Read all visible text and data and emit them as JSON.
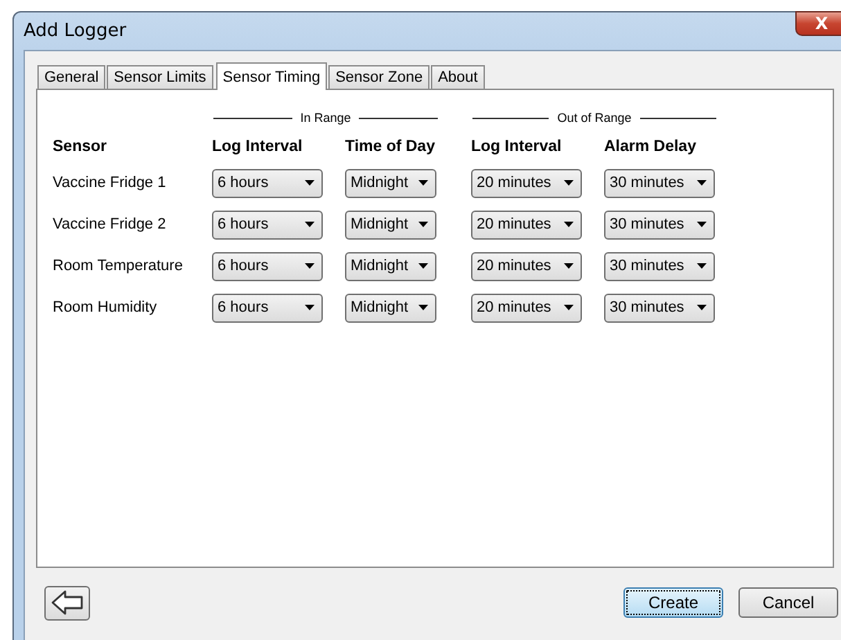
{
  "window": {
    "title": "Add Logger",
    "close_label": "X"
  },
  "tabs": [
    {
      "label": "General",
      "selected": false
    },
    {
      "label": "Sensor Limits",
      "selected": false
    },
    {
      "label": "Sensor Timing",
      "selected": true
    },
    {
      "label": "Sensor Zone",
      "selected": false
    },
    {
      "label": "About",
      "selected": false
    }
  ],
  "groups": [
    {
      "label": "In Range"
    },
    {
      "label": "Out of Range"
    }
  ],
  "columns": [
    "Sensor",
    "Log Interval",
    "Time of Day",
    "Log Interval",
    "Alarm Delay"
  ],
  "rows": [
    {
      "sensor": "Vaccine Fridge 1",
      "values": [
        "6 hours",
        "Midnight",
        "20 minutes",
        "30 minutes"
      ]
    },
    {
      "sensor": "Vaccine Fridge 2",
      "values": [
        "6 hours",
        "Midnight",
        "20 minutes",
        "30 minutes"
      ]
    },
    {
      "sensor": "Room Temperature",
      "values": [
        "6 hours",
        "Midnight",
        "20 minutes",
        "30 minutes"
      ]
    },
    {
      "sensor": "Room Humidity",
      "values": [
        "6 hours",
        "Midnight",
        "20 minutes",
        "30 minutes"
      ]
    }
  ],
  "buttons": [
    {
      "label": "Create",
      "default": true
    },
    {
      "label": "Cancel",
      "default": false
    }
  ]
}
